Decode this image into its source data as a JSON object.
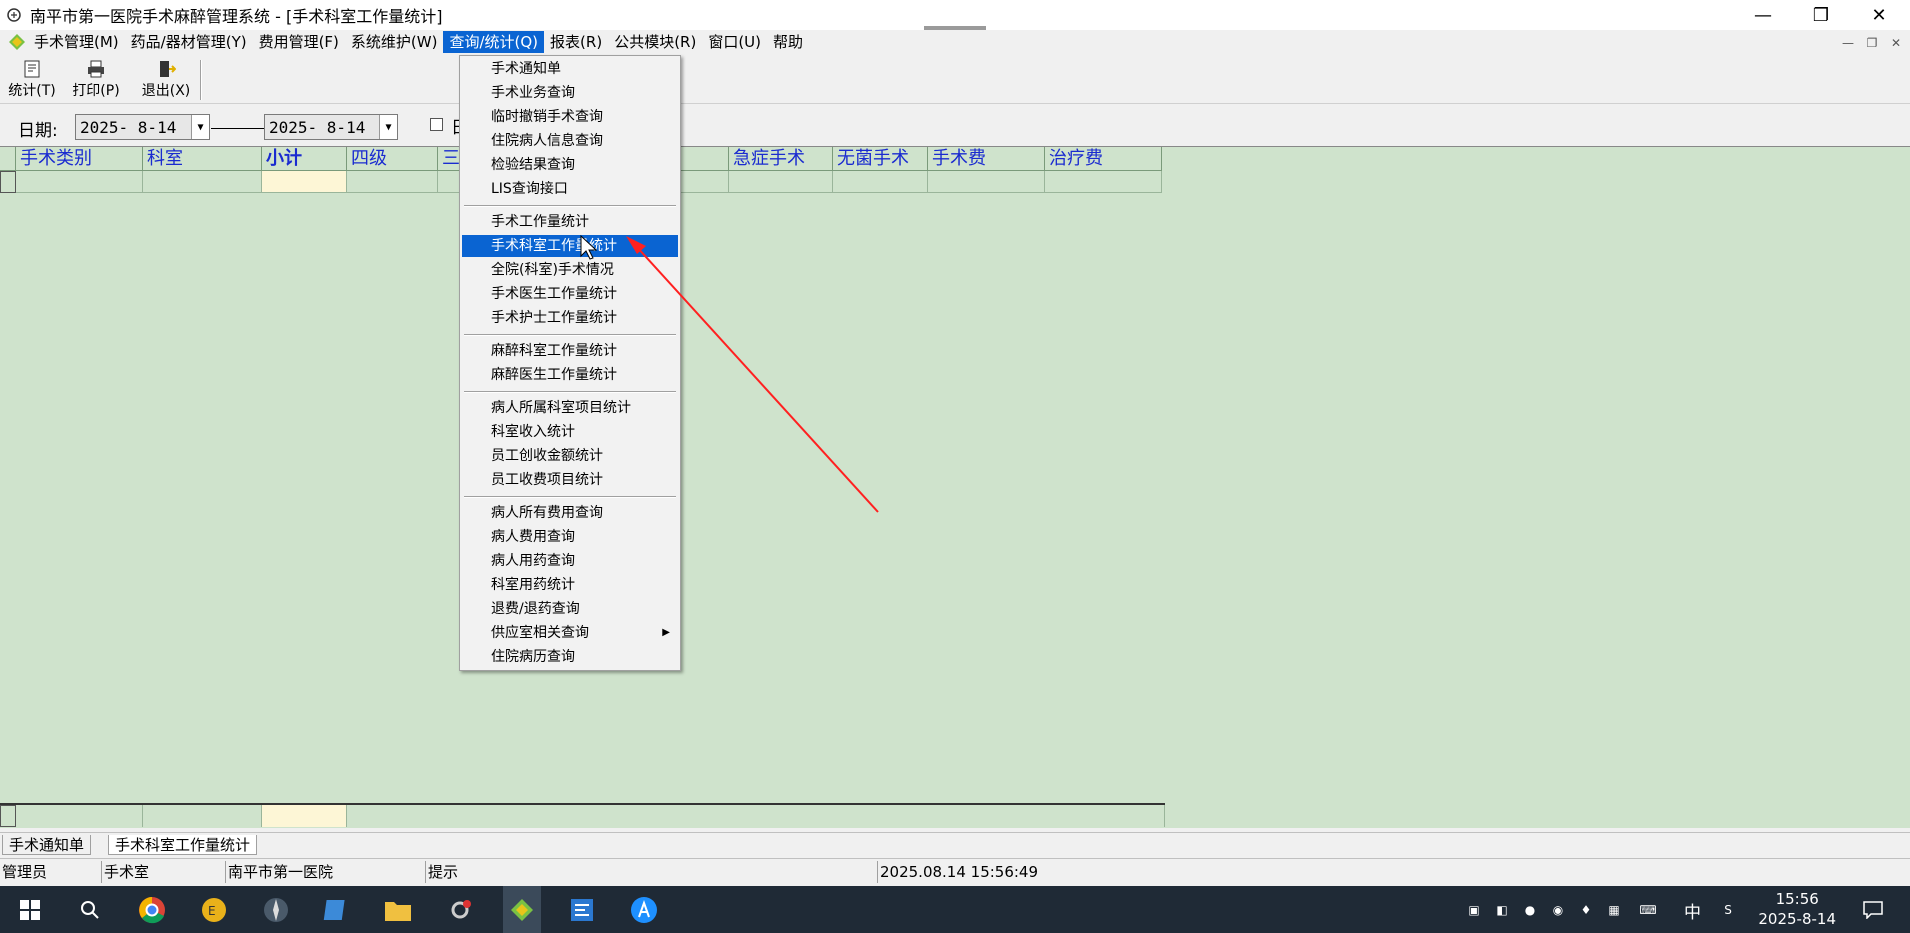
{
  "window": {
    "title": "南平市第一医院手术麻醉管理系统 - [手术科室工作量统计]",
    "controls": {
      "minimize": "—",
      "restore": "❐",
      "close": "✕"
    }
  },
  "menubar": {
    "items": [
      "手术管理(M)",
      "药品/器材管理(Y)",
      "费用管理(F)",
      "系统维护(W)",
      "查询/统计(Q)",
      "报表(R)",
      "公共模块(R)",
      "窗口(U)",
      "帮助"
    ],
    "active_index": 4
  },
  "toolbar": {
    "stat_label": "统计(T)",
    "print_label": "打印(P)",
    "exit_label": "退出(X)"
  },
  "filter": {
    "date_label": "日期:",
    "date_from": "2025- 8-14",
    "date_to": "2025- 8-14",
    "checkbox_label": "日"
  },
  "grid": {
    "columns": [
      "手术类别",
      "科室",
      "小计",
      "四级",
      "三",
      "",
      "",
      "急症手术",
      "无菌手术",
      "手术费",
      "治疗费"
    ]
  },
  "query_menu": {
    "groups": [
      [
        "手术通知单",
        "手术业务查询",
        "临时撤销手术查询",
        "住院病人信息查询",
        "检验结果查询",
        "LIS查询接口"
      ],
      [
        "手术工作量统计",
        "手术科室工作量统计",
        "全院(科室)手术情况",
        "手术医生工作量统计",
        "手术护士工作量统计"
      ],
      [
        "麻醉科室工作量统计",
        "麻醉医生工作量统计"
      ],
      [
        "病人所属科室项目统计",
        "科室收入统计",
        "员工创收金额统计",
        "员工收费项目统计"
      ],
      [
        "病人所有费用查询",
        "病人费用查询",
        "病人用药查询",
        "科室用药统计",
        "退费/退药查询",
        "供应室相关查询",
        "住院病历查询"
      ]
    ],
    "selected": "手术科室工作量统计",
    "submenu_item": "供应室相关查询"
  },
  "tabs": [
    "手术通知单",
    "手术科室工作量统计"
  ],
  "active_tab": 1,
  "status": {
    "user": "管理员",
    "dept": "手术室",
    "hospital": "南平市第一医院",
    "hint": "提示",
    "datetime": "2025.08.14 15:56:49"
  },
  "taskbar": {
    "time": "15:56",
    "date": "2025-8-14",
    "ime": "中"
  },
  "colors": {
    "menu_highlight": "#0a64d2",
    "grid_bg": "#cfe3cc",
    "header_text": "#1a2bd0",
    "arrow": "#ff2020"
  }
}
